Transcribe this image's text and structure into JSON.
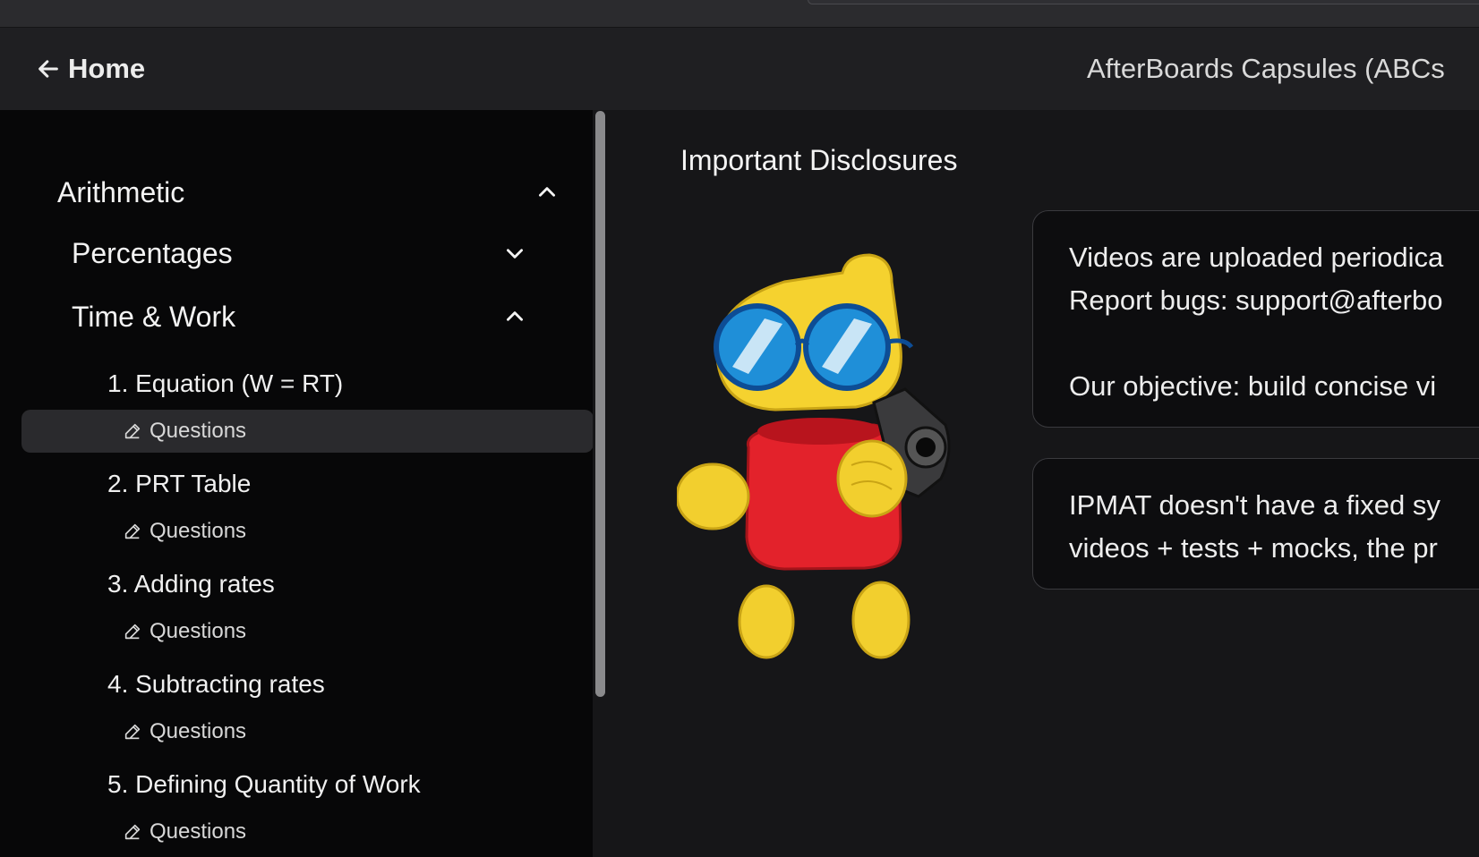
{
  "header": {
    "home_label": "Home",
    "course_title": "AfterBoards Capsules (ABCs"
  },
  "sidebar": {
    "section": {
      "label": "Arithmetic",
      "expanded": true
    },
    "subsections": [
      {
        "label": "Percentages",
        "expanded": false
      },
      {
        "label": "Time & Work",
        "expanded": true
      }
    ],
    "lessons": [
      {
        "label": "1. Equation (W = RT)",
        "sub_label": "Questions",
        "active": true
      },
      {
        "label": "2. PRT Table",
        "sub_label": "Questions",
        "active": false
      },
      {
        "label": "3. Adding rates",
        "sub_label": "Questions",
        "active": false
      },
      {
        "label": "4. Subtracting rates",
        "sub_label": "Questions",
        "active": false
      },
      {
        "label": "5. Defining Quantity of Work",
        "sub_label": "Questions",
        "active": false
      }
    ]
  },
  "main": {
    "title": "Important Disclosures",
    "card1": {
      "line1": "Videos are uploaded periodica",
      "line2": "Report bugs: support@afterbo",
      "line3": "Our objective: build concise vi"
    },
    "card2": {
      "line1": "IPMAT doesn't have a fixed sy",
      "line2": "videos + tests + mocks, the pr"
    }
  },
  "icons": {
    "back": "arrow-left-icon",
    "expanded": "chevron-up-icon",
    "collapsed": "chevron-down-icon",
    "questions": "pencil-icon",
    "mascot": "mascot-illustration"
  },
  "colors": {
    "sidebar_bg": "#070708",
    "main_bg": "#161618",
    "header_bg": "#1f1f22",
    "active_row_bg": "#2a2a2d"
  }
}
